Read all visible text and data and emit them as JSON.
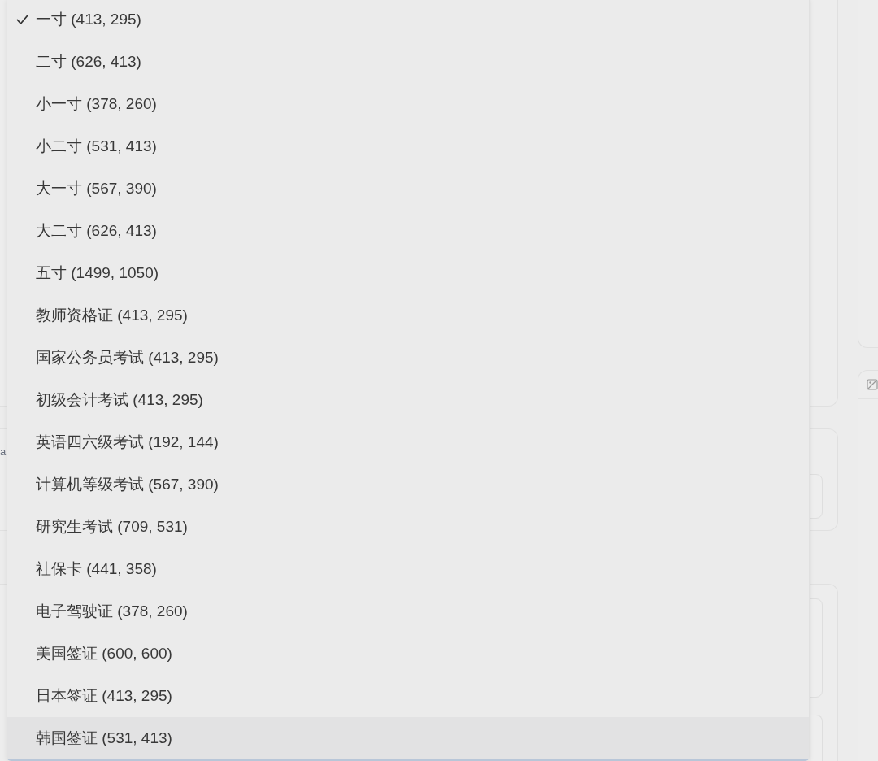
{
  "background": {
    "fragments": [
      "a"
    ]
  },
  "dropdown": {
    "items": [
      {
        "label": "一寸 (413, 295)",
        "selected": true,
        "highlighted": false
      },
      {
        "label": "二寸 (626, 413)",
        "selected": false,
        "highlighted": false
      },
      {
        "label": "小一寸 (378, 260)",
        "selected": false,
        "highlighted": false
      },
      {
        "label": "小二寸 (531, 413)",
        "selected": false,
        "highlighted": false
      },
      {
        "label": "大一寸 (567, 390)",
        "selected": false,
        "highlighted": false
      },
      {
        "label": "大二寸 (626, 413)",
        "selected": false,
        "highlighted": false
      },
      {
        "label": "五寸 (1499, 1050)",
        "selected": false,
        "highlighted": false
      },
      {
        "label": "教师资格证 (413, 295)",
        "selected": false,
        "highlighted": false
      },
      {
        "label": "国家公务员考试 (413, 295)",
        "selected": false,
        "highlighted": false
      },
      {
        "label": "初级会计考试 (413, 295)",
        "selected": false,
        "highlighted": false
      },
      {
        "label": "英语四六级考试 (192, 144)",
        "selected": false,
        "highlighted": false
      },
      {
        "label": "计算机等级考试 (567, 390)",
        "selected": false,
        "highlighted": false
      },
      {
        "label": "研究生考试 (709, 531)",
        "selected": false,
        "highlighted": false
      },
      {
        "label": "社保卡 (441, 358)",
        "selected": false,
        "highlighted": false
      },
      {
        "label": "电子驾驶证 (378, 260)",
        "selected": false,
        "highlighted": false
      },
      {
        "label": "美国签证 (600, 600)",
        "selected": false,
        "highlighted": false
      },
      {
        "label": "日本签证 (413, 295)",
        "selected": false,
        "highlighted": false
      },
      {
        "label": "韩国签证 (531, 413)",
        "selected": false,
        "highlighted": true
      }
    ]
  }
}
